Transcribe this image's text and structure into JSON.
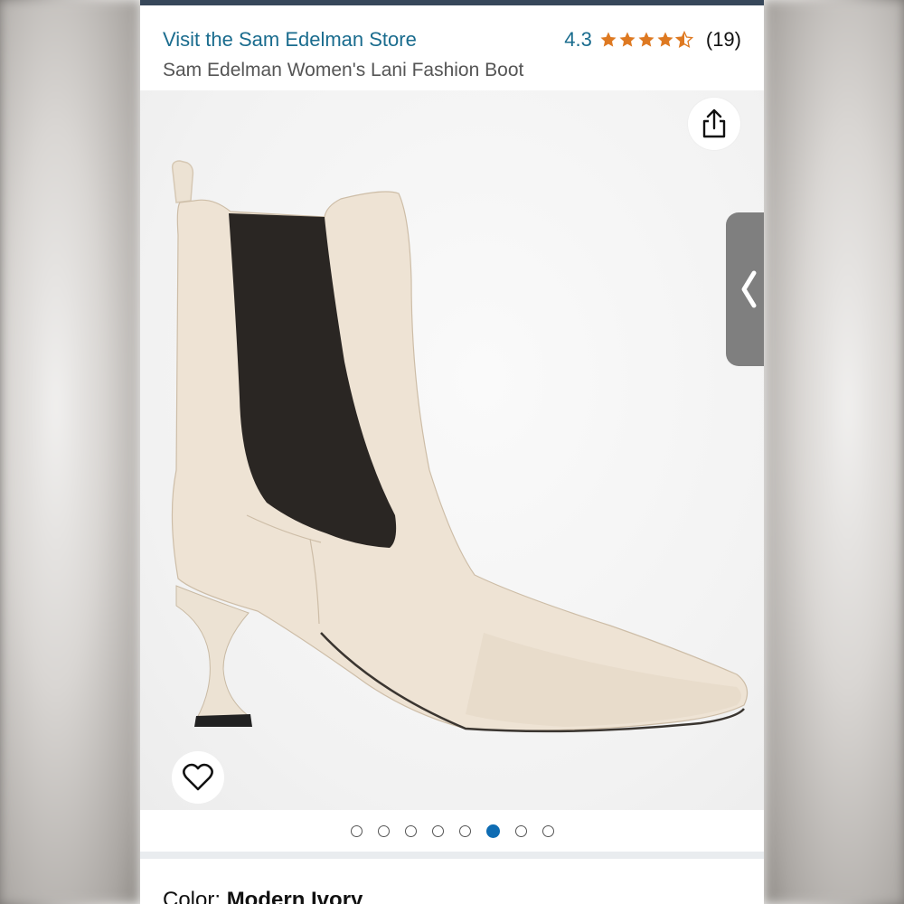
{
  "header": {
    "store_link": "Visit the Sam Edelman Store",
    "rating_value": "4.3",
    "rating_stars": 4.3,
    "rating_count": "(19)",
    "product_title": "Sam Edelman Women's Lani Fashion Boot"
  },
  "gallery": {
    "share_icon": "share-icon",
    "side_tab_icon": "chevron-left-icon",
    "favorite_icon": "heart-icon",
    "dots_total": 8,
    "active_dot": 6
  },
  "color": {
    "label": "Color: ",
    "value": "Modern Ivory"
  },
  "colors": {
    "topbar": "#37475a",
    "link": "#1a6c8e",
    "star": "#de7921",
    "active_dot": "#0f6cb3"
  }
}
